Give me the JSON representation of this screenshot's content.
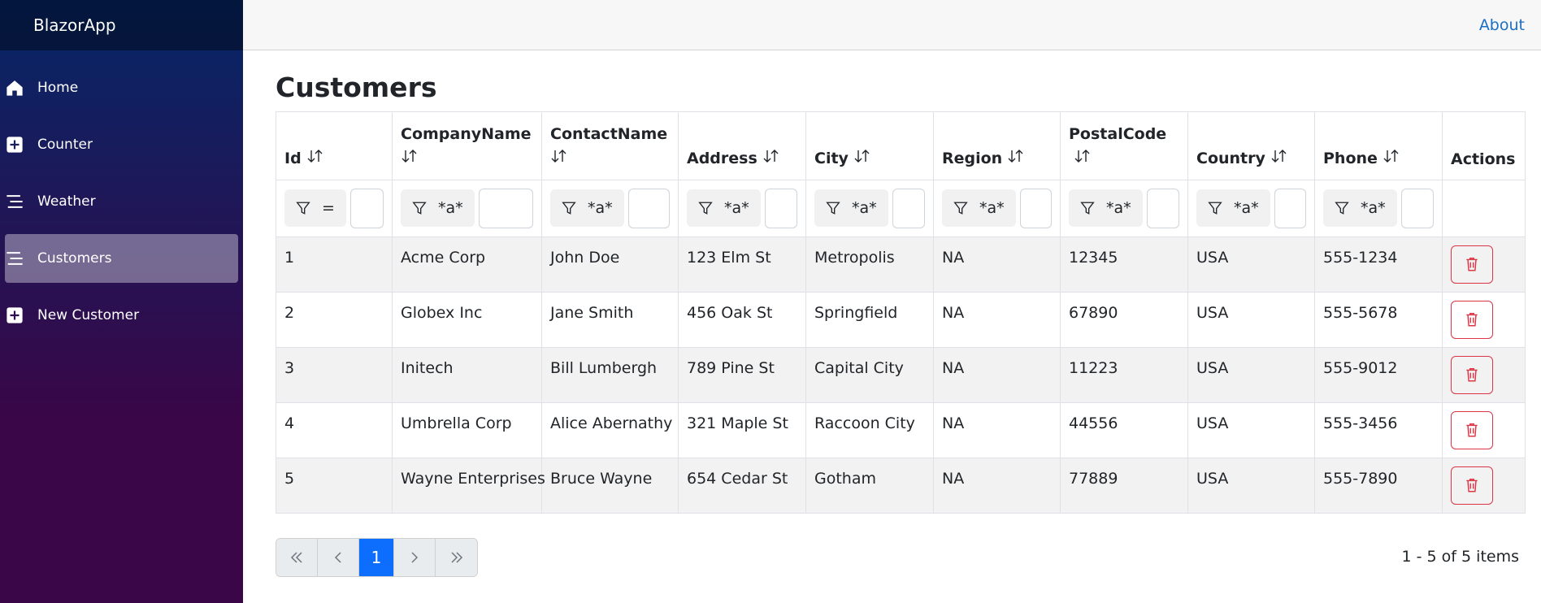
{
  "app": {
    "brand": "BlazorApp"
  },
  "sidebar": {
    "items": [
      {
        "label": "Home",
        "icon": "home-icon",
        "active": false
      },
      {
        "label": "Counter",
        "icon": "plus-square-icon",
        "active": false
      },
      {
        "label": "Weather",
        "icon": "list-icon",
        "active": false
      },
      {
        "label": "Customers",
        "icon": "list-icon",
        "active": true
      },
      {
        "label": "New Customer",
        "icon": "plus-square-icon",
        "active": false
      }
    ]
  },
  "header": {
    "about": "About"
  },
  "page": {
    "title": "Customers"
  },
  "grid": {
    "columns": [
      "Id",
      "CompanyName",
      "ContactName",
      "Address",
      "City",
      "Region",
      "PostalCode",
      "Country",
      "Phone",
      "Actions"
    ],
    "filters": [
      "=",
      "*a*",
      "*a*",
      "*a*",
      "*a*",
      "*a*",
      "*a*",
      "*a*",
      "*a*"
    ],
    "rows": [
      [
        "1",
        "Acme Corp",
        "John Doe",
        "123 Elm St",
        "Metropolis",
        "NA",
        "12345",
        "USA",
        "555-1234"
      ],
      [
        "2",
        "Globex Inc",
        "Jane Smith",
        "456 Oak St",
        "Springfield",
        "NA",
        "67890",
        "USA",
        "555-5678"
      ],
      [
        "3",
        "Initech",
        "Bill Lumbergh",
        "789 Pine St",
        "Capital City",
        "NA",
        "11223",
        "USA",
        "555-9012"
      ],
      [
        "4",
        "Umbrella Corp",
        "Alice Abernathy",
        "321 Maple St",
        "Raccoon City",
        "NA",
        "44556",
        "USA",
        "555-3456"
      ],
      [
        "5",
        "Wayne Enterprises",
        "Bruce Wayne",
        "654 Cedar St",
        "Gotham",
        "NA",
        "77889",
        "USA",
        "555-7890"
      ]
    ]
  },
  "pager": {
    "current_page": "1",
    "summary": "1 - 5 of 5 items"
  },
  "colors": {
    "accent": "#0d6efd",
    "danger": "#dc3545",
    "link": "#1b6ec2"
  }
}
